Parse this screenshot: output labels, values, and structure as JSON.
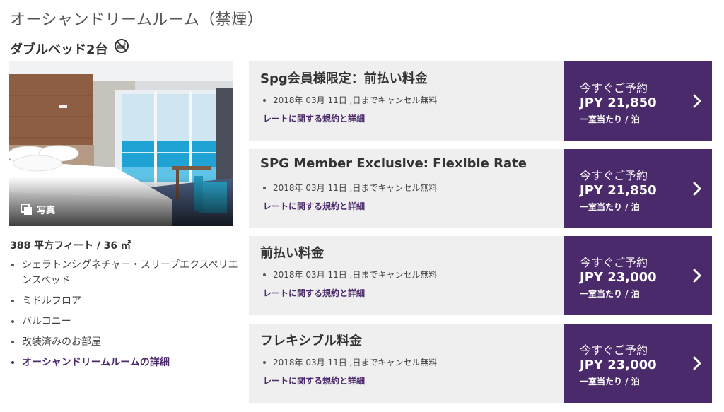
{
  "room": {
    "title": "オーシャンドリームルーム（禁煙）",
    "bed_type": "ダブルベッド2台",
    "smoking_icon": "no-smoking-icon",
    "photo_label": "写真",
    "size": "388 平方フィート / 36 ㎡",
    "features": [
      "シェラトンシグネチャー・スリープエクスペリエンスベッド",
      "ミドルフロア",
      "バルコニー",
      "改装済みのお部屋"
    ],
    "detail_link": "オーシャンドリームルームの詳細"
  },
  "rates": [
    {
      "name": "Spg会員様限定：前払い料金",
      "cancel": "2018年 03月 11日 ,日までキャンセル無料",
      "terms": "レートに関する規約と詳細",
      "book_label": "今すぐご予約",
      "price": "JPY 21,850",
      "unit": "一室当たり / 泊"
    },
    {
      "name": "SPG Member Exclusive: Flexible Rate",
      "cancel": "2018年 03月 11日 ,日までキャンセル無料",
      "terms": "レートに関する規約と詳細",
      "book_label": "今すぐご予約",
      "price": "JPY 21,850",
      "unit": "一室当たり / 泊"
    },
    {
      "name": "前払い料金",
      "cancel": "2018年 03月 11日 ,日までキャンセル無料",
      "terms": "レートに関する規約と詳細",
      "book_label": "今すぐご予約",
      "price": "JPY 23,000",
      "unit": "一室当たり / 泊"
    },
    {
      "name": "フレキシブル料金",
      "cancel": "2018年 03月 11日 ,日までキャンセル無料",
      "terms": "レートに関する規約と詳細",
      "book_label": "今すぐご予約",
      "price": "JPY 23,000",
      "unit": "一室当たり / 泊"
    }
  ],
  "colors": {
    "brand_purple": "#4b2a6b",
    "card_background": "#efefef"
  }
}
